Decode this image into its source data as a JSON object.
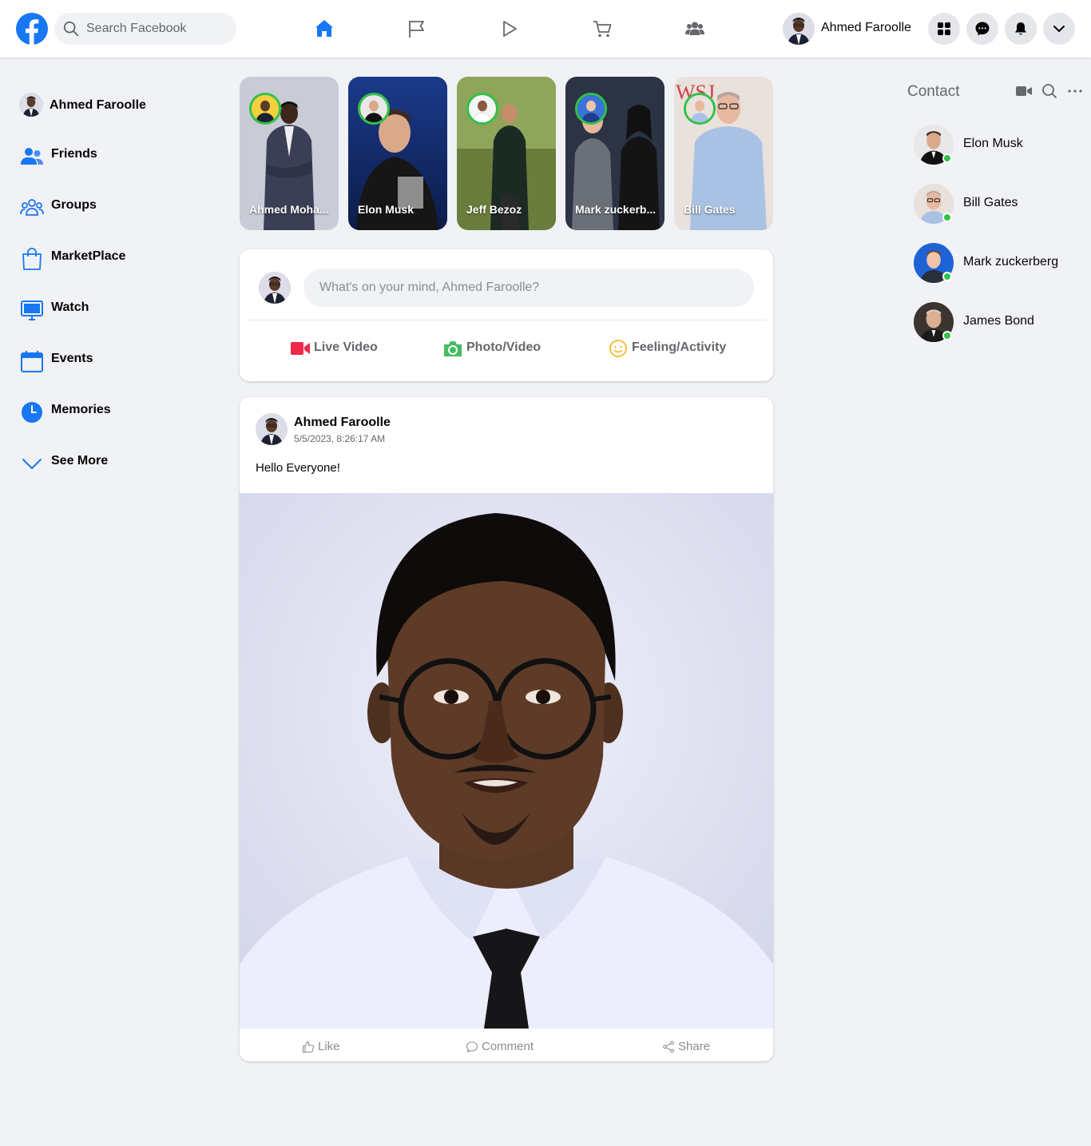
{
  "header": {
    "search_placeholder": "Search Facebook",
    "user_name": "Ahmed Faroolle",
    "nav_icons": [
      "home-icon",
      "flag-icon",
      "play-icon",
      "cart-icon",
      "groups-icon"
    ],
    "action_icons": [
      "menu-grid-icon",
      "messenger-icon",
      "bell-icon",
      "chevron-down-icon"
    ],
    "accent_color": "#1877f2"
  },
  "sidebar": {
    "profile_name": "Ahmed Faroolle",
    "items": [
      {
        "label": "Friends",
        "icon": "friends-icon"
      },
      {
        "label": "Groups",
        "icon": "groups-icon"
      },
      {
        "label": "MarketPlace",
        "icon": "shopping-bag-icon"
      },
      {
        "label": "Watch",
        "icon": "monitor-icon"
      },
      {
        "label": "Events",
        "icon": "calendar-icon"
      },
      {
        "label": "Memories",
        "icon": "clock-icon"
      },
      {
        "label": "See More",
        "icon": "chevron-down-icon"
      }
    ]
  },
  "stories": [
    {
      "name": "Ahmed Moha..."
    },
    {
      "name": "Elon Musk"
    },
    {
      "name": "Jeff Bezoz"
    },
    {
      "name": "Mark zuckerb..."
    },
    {
      "name": "Bill Gates"
    }
  ],
  "composer": {
    "placeholder": "What's on your mind, Ahmed Faroolle?",
    "actions": [
      {
        "label": "Live Video",
        "color": "#f02849"
      },
      {
        "label": "Photo/Video",
        "color": "#45bd62"
      },
      {
        "label": "Feeling/Activity",
        "color": "#f7b928"
      }
    ]
  },
  "post": {
    "author": "Ahmed Faroolle",
    "timestamp": "5/5/2023, 8:26:17 AM",
    "text": "Hello Everyone!",
    "actions": {
      "like": "Like",
      "comment": "Comment",
      "share": "Share"
    }
  },
  "contacts": {
    "title": "Contact",
    "online_color": "#31c24a",
    "people": [
      {
        "name": "Elon Musk"
      },
      {
        "name": "Bill Gates"
      },
      {
        "name": "Mark zuckerberg"
      },
      {
        "name": "James Bond"
      }
    ]
  }
}
